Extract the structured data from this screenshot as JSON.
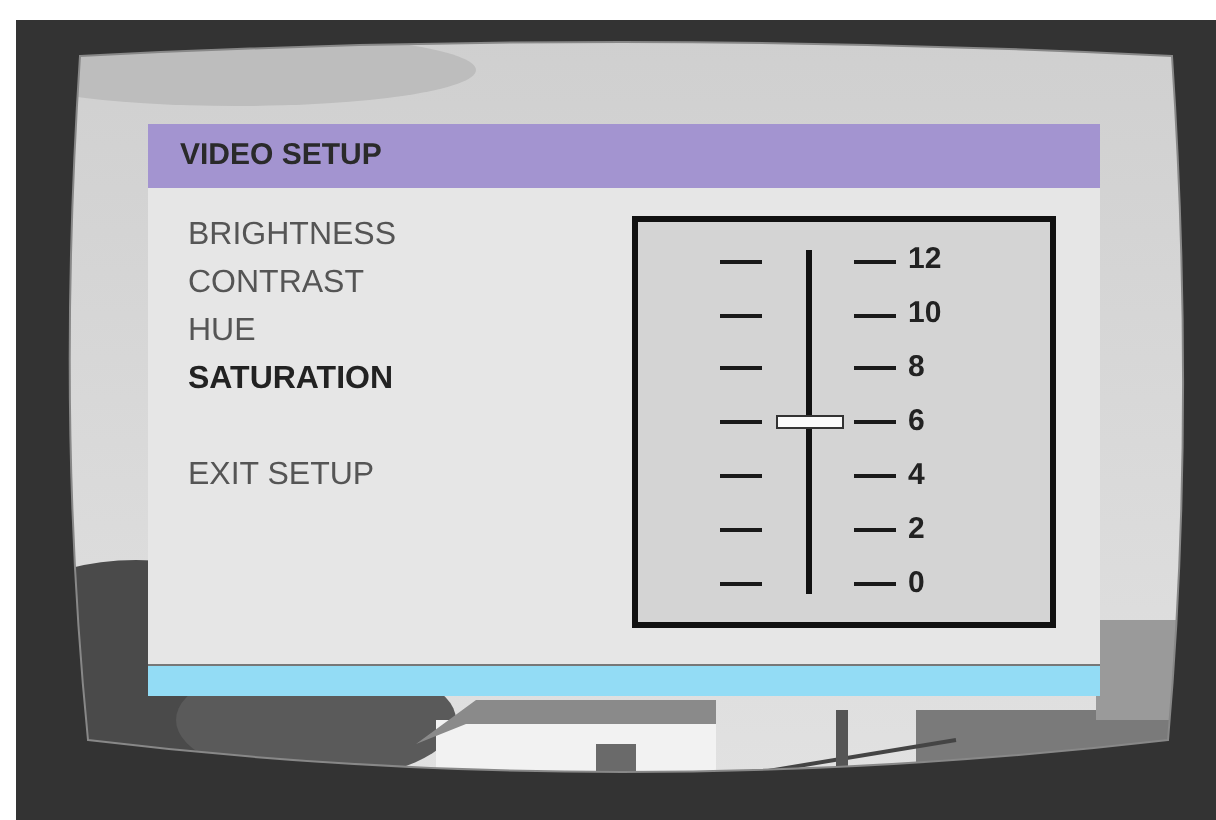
{
  "menu": {
    "title": "VIDEO SETUP",
    "items": [
      {
        "label": "BRIGHTNESS",
        "selected": false
      },
      {
        "label": "CONTRAST",
        "selected": false
      },
      {
        "label": "HUE",
        "selected": false
      },
      {
        "label": "SATURATION",
        "selected": true
      },
      {
        "kind": "gap"
      },
      {
        "label": "EXIT SETUP",
        "selected": false
      }
    ]
  },
  "slider": {
    "labels": [
      "12",
      "10",
      "8",
      "6",
      "4",
      "2",
      "0"
    ],
    "level": 0.5
  }
}
